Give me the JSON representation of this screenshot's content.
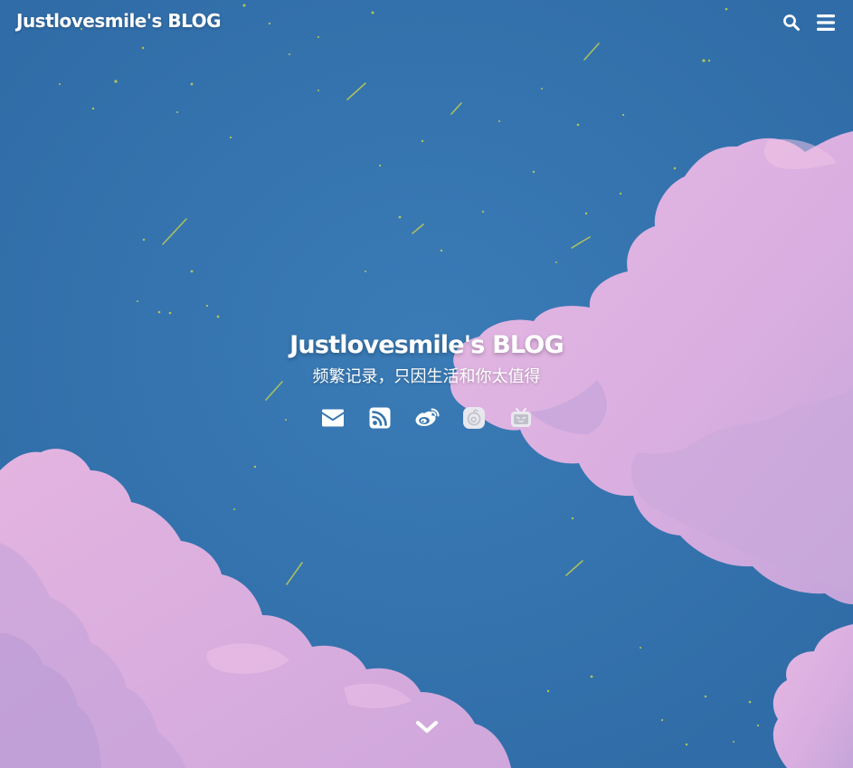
{
  "header": {
    "site_name": "Justlovesmile's BLOG"
  },
  "top_icons": [
    "search-icon",
    "menu-icon"
  ],
  "hero": {
    "title": "Justlovesmile's BLOG",
    "subtitle": "频繁记录，只因生活和你太值得"
  },
  "social_links": [
    "email-icon",
    "rss-icon",
    "weibo-icon",
    "netease-music-icon",
    "bilibili-icon"
  ],
  "scroll_icon": "chevron-down-icon",
  "colors": {
    "sky": "#3373ad",
    "cloud": "#e3b3e0",
    "cloud_shadow": "#b8a2d6",
    "star": "#c9d34a",
    "text": "#ffffff"
  }
}
